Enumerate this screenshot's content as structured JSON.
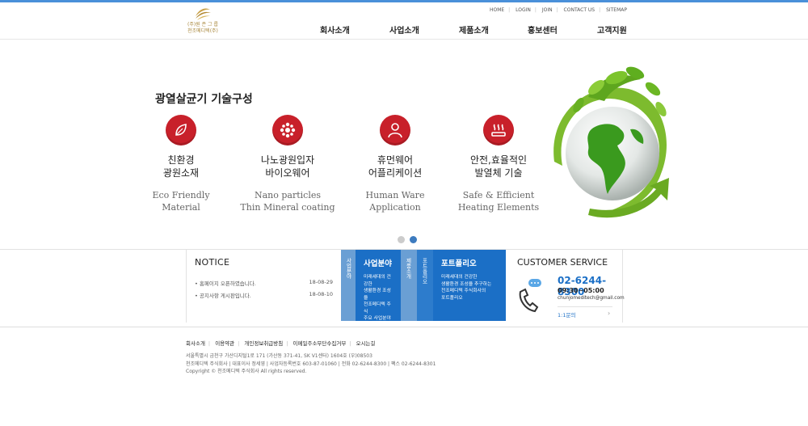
{
  "logo": {
    "line1": "(주)원 존 그 룹",
    "line2": "천조메디텍(주)"
  },
  "util": [
    "HOME",
    "LOGIN",
    "JOIN",
    "CONTACT US",
    "SITEMAP"
  ],
  "gnb": [
    "회사소개",
    "사업소개",
    "제품소개",
    "홍보센터",
    "고객지원"
  ],
  "hero": {
    "title": "광열살균기 기술구성",
    "features": [
      {
        "ko1": "친환경",
        "ko2": "광원소재",
        "en1": "Eco Friendly",
        "en2": "Material",
        "icon": "leaf-icon"
      },
      {
        "ko1": "나노광원입자",
        "ko2": "바이오웨어",
        "en1": "Nano particles",
        "en2": "Thin Mineral coating",
        "icon": "nano-particle-icon"
      },
      {
        "ko1": "휴먼웨어",
        "ko2": "어플리케이션",
        "en1": "Human Ware",
        "en2": "Application",
        "icon": "person-icon"
      },
      {
        "ko1": "안전,효율적인",
        "ko2": "발열체 기술",
        "en1": "Safe & Efficient",
        "en2": "Heating Elements",
        "icon": "heat-icon"
      }
    ],
    "slides": 2,
    "active_slide": 2
  },
  "notice": {
    "title": "NOTICE",
    "items": [
      {
        "text": "• 홈페이지 오픈하였습니다.",
        "date": "18-08-29"
      },
      {
        "text": "• 공지사항 게시판입니다.",
        "date": "18-08-10"
      }
    ]
  },
  "panels": {
    "tab1": "사업분야",
    "business": {
      "title": "사업분야",
      "desc": [
        "미래세대의 건강한",
        "생활환경 조성을",
        "천조메디텍 주식",
        "주요 사업분야"
      ]
    },
    "tab2": "제품소개",
    "tab3": "포트폴리오",
    "portfolio": {
      "title": "포트폴리오",
      "desc": [
        "미래세대의 건강한",
        "생활환경 조성을 추구하는",
        "천조메디텍 주식회사의",
        "포트폴리오"
      ]
    }
  },
  "cs": {
    "title": "CUSTOMER SERVICE",
    "phone": "02-6244-8300",
    "hours": "09:30~05:00",
    "email": "chunjomeditech@gmail.com",
    "qa": "1:1문의"
  },
  "footer": {
    "menu": [
      "회사소개",
      "이용약관",
      "개인정보취급방침",
      "이메일주소무단수집거부",
      "오시는길"
    ],
    "lines": [
      "서울특별시 금천구 가산디지털1로 171 (가산동 371-41, SK V1센터) 1604호 (우)08503",
      "천조메디텍 주식회사  |  대표이사 정세영  |  사업자등록번호 603-87-01060  |  전화 02-6244-8300  |  팩스 02-6244-8301",
      "Copyright © 천조메디텍 주식회사 All rights reserved."
    ]
  },
  "colors": {
    "accent": "#1b6fc6",
    "light_accent": "#6a9fd4",
    "icon_red": "#c8202a",
    "top_line": "#4a90d9"
  }
}
